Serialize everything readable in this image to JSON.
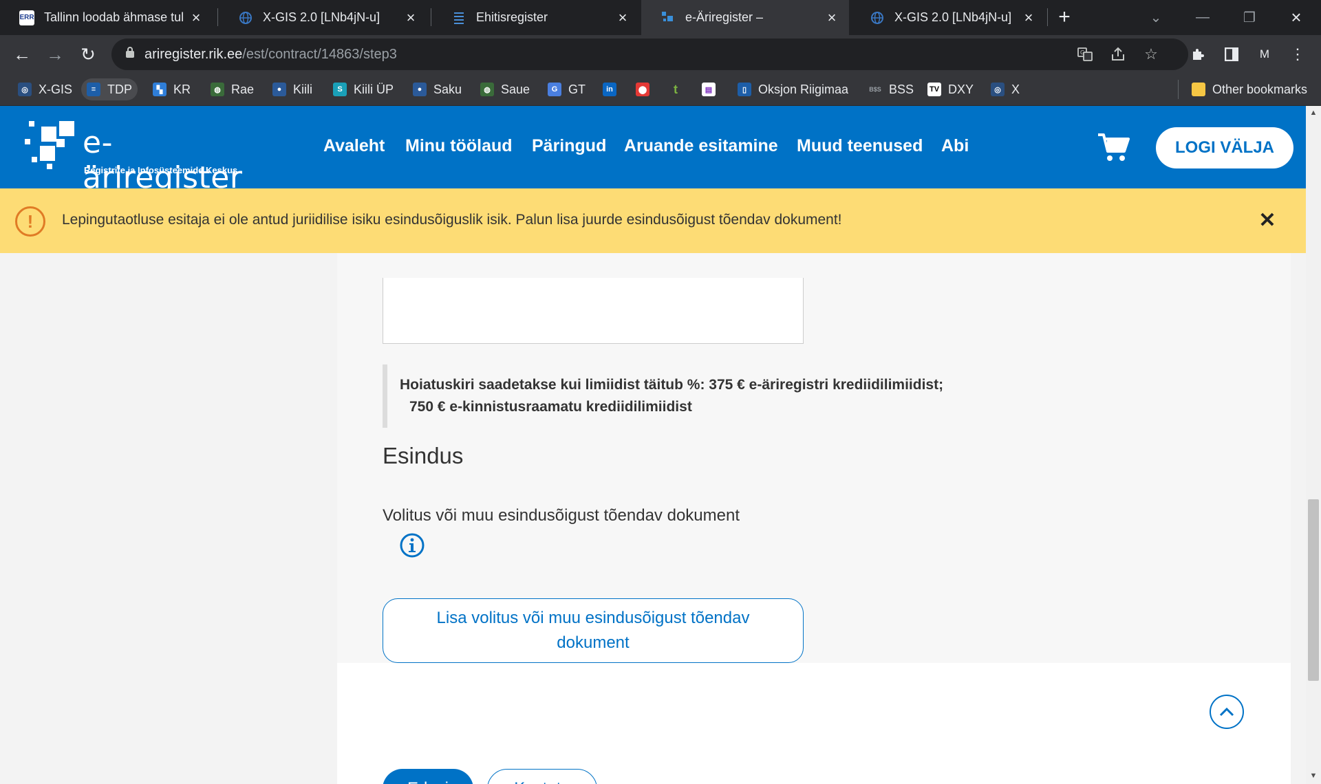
{
  "browser": {
    "tabs": [
      {
        "title": "Tallinn loodab ähmase tul",
        "icon": "err-icon",
        "favicon_text": "ERR"
      },
      {
        "title": "X-GIS 2.0 [LNb4jN-u]",
        "icon": "globe-icon"
      },
      {
        "title": "Ehitisregister",
        "icon": "ehr-icon"
      },
      {
        "title": "e-Äriregister –",
        "icon": "rik-icon"
      },
      {
        "title": "X-GIS 2.0 [LNb4jN-u]",
        "icon": "globe-icon"
      }
    ],
    "new_tab_glyph": "+",
    "url_host": "ariregister.rik.ee",
    "url_path": "/est/contract/14863/step3",
    "profile_letter": "M",
    "bookmarks": [
      {
        "label": "X-GIS"
      },
      {
        "label": "TDP"
      },
      {
        "label": "KR"
      },
      {
        "label": "Rae"
      },
      {
        "label": "Kiili"
      },
      {
        "label": "Kiili ÜP"
      },
      {
        "label": "Saku"
      },
      {
        "label": "Saue"
      },
      {
        "label": "GT"
      },
      {
        "label": ""
      },
      {
        "label": ""
      },
      {
        "label": ""
      },
      {
        "label": ""
      },
      {
        "label": "Oksjon Riigimaa"
      },
      {
        "label": "BSS"
      },
      {
        "label": "DXY"
      },
      {
        "label": "X"
      }
    ],
    "other_bookmarks": "Other bookmarks"
  },
  "site": {
    "logo_text": "e-äriregister",
    "logo_subline": "Registrite ja Infosüsteemide Keskus",
    "nav": [
      "Avaleht",
      "Minu töölaud",
      "Päringud",
      "Aruande esitamine",
      "Muud teenused",
      "Abi"
    ],
    "logout_label": "LOGI VÄLJA",
    "brand_color": "#0072c6",
    "alert_color": "#fddc75"
  },
  "alert": {
    "message": "Lepingutaotluse esitaja ei ole antud juriidilise isiku esindusõiguslik isik. Palun lisa juurde esindusõigust tõendav dokument!"
  },
  "form": {
    "note_line1": "Hoiatuskiri saadetakse kui limiidist täitub %:    375 € e-äriregistri krediidilimiidist;",
    "note_line2": "750 € e-kinnistusraamatu krediidilimiidist",
    "section_title": "Esindus",
    "document_label": "Volitus või muu esindusõigust tõendav dokument",
    "add_document_button": "Lisa volitus või muu esindusõigust tõendav dokument",
    "next_button": "Edasi",
    "delete_button": "Kustuta"
  }
}
